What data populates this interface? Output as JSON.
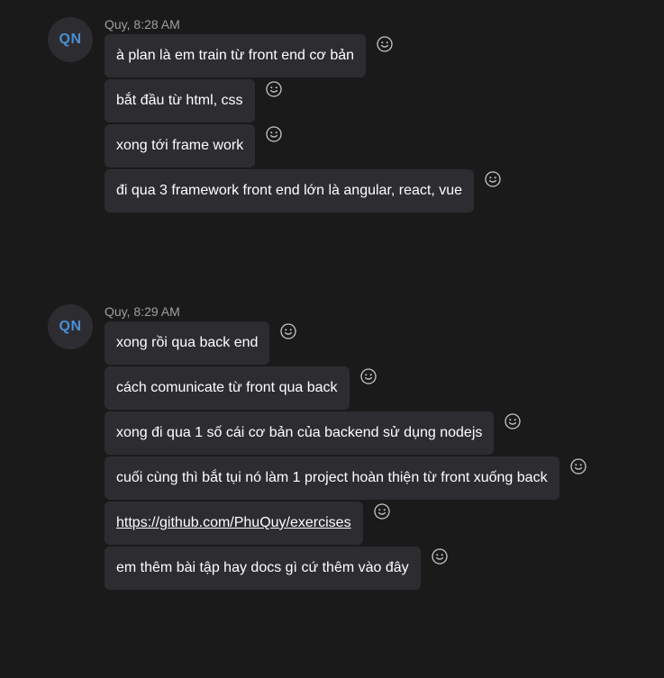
{
  "groups": [
    {
      "avatar_initials": "QN",
      "meta": "Quy, 8:28 AM",
      "messages": [
        {
          "text": "à plan là em train từ front end cơ bản"
        },
        {
          "text": "bắt đầu từ html, css"
        },
        {
          "text": "xong tới frame work"
        },
        {
          "text": "đi qua 3 framework front end lớn là angular, react, vue"
        }
      ]
    },
    {
      "avatar_initials": "QN",
      "meta": "Quy, 8:29 AM",
      "messages": [
        {
          "text": "xong rồi qua back end"
        },
        {
          "text": "cách comunicate từ front qua back"
        },
        {
          "text": "xong đi qua 1 số cái cơ bản của backend sử dụng nodejs"
        },
        {
          "text": "cuối cùng thì bắt tụi nó làm 1 project hoàn thiện từ front xuống back"
        },
        {
          "text": "https://github.com/PhuQuy/exercises",
          "link": true
        },
        {
          "text": "em thêm bài tập hay docs gì cứ thêm vào đây"
        }
      ]
    }
  ],
  "icons": {
    "reaction": "smiley-face-icon"
  },
  "colors": {
    "background": "#1b1a1b",
    "bubble": "#2d2c30",
    "avatar_text": "#4a8fd6",
    "meta_text": "#a19f9d",
    "message_text": "#ffffff"
  }
}
